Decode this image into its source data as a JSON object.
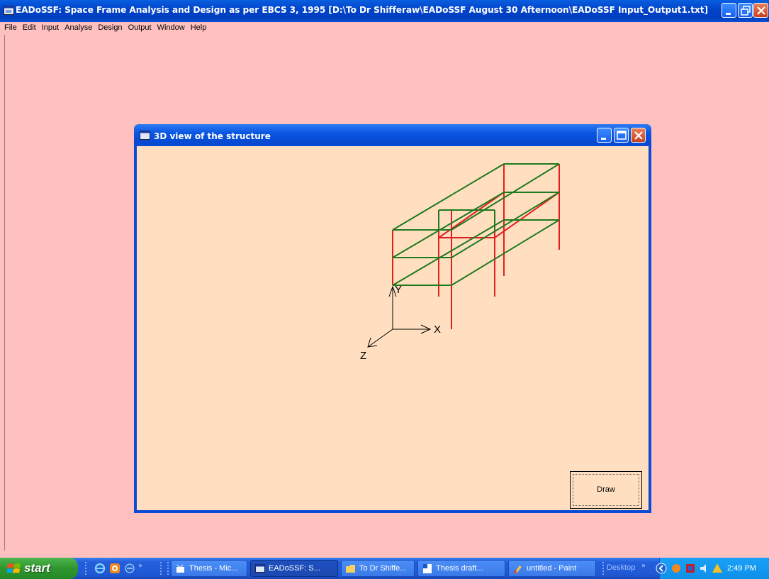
{
  "main_window": {
    "title": "EADoSSF: Space Frame Analysis and Design as per EBCS 3, 1995 [D:\\To Dr Shifferaw\\EADoSSF August 30 Afternoon\\EADoSSF Input_Output1.txt]",
    "icon": "app-window-icon",
    "controls": [
      "minimize-icon",
      "restore-icon",
      "close-icon"
    ]
  },
  "menu": {
    "items": [
      "File",
      "Edit",
      "Input",
      "Analyse",
      "Design",
      "Output",
      "Window",
      "Help"
    ]
  },
  "child_window": {
    "title": "3D view of the structure",
    "icon": "form-window-icon",
    "controls": [
      "minimize-icon",
      "maximize-icon",
      "close-icon"
    ]
  },
  "view3d": {
    "axis_labels": {
      "x": "X",
      "y": "Y",
      "z": "Z"
    },
    "colors": {
      "beams": "#1e7a1e",
      "columns": "#e02020",
      "axes": "#000000"
    }
  },
  "draw_button": {
    "label": "Draw"
  },
  "taskbar": {
    "start_label": "start",
    "quick_launch": [
      "ie-icon",
      "media-icon",
      "browser-icon"
    ],
    "tasks": [
      {
        "label": "Thesis - Mic...",
        "icon": "explorer-icon",
        "active": false
      },
      {
        "label": "EADoSSF: S...",
        "icon": "app-window-icon",
        "active": true
      },
      {
        "label": "To Dr Shiffe...",
        "icon": "folder-icon",
        "active": false
      },
      {
        "label": "Thesis draft...",
        "icon": "word-icon",
        "active": false
      },
      {
        "label": "untitled - Paint",
        "icon": "paint-icon",
        "active": false
      }
    ],
    "desktop_label": "Desktop",
    "tray_icons": [
      "back-arrow-icon",
      "network-icon",
      "security-icon",
      "volume-icon",
      "update-icon"
    ],
    "clock": "2:49 PM"
  }
}
